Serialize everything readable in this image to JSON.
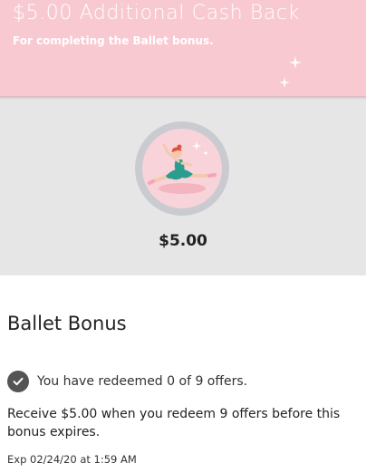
{
  "banner": {
    "title": "$5.00 Additional Cash Back",
    "subtitle": "For completing the Ballet bonus.",
    "background": "#f9c9d1"
  },
  "hero": {
    "badge_icon": "ballerina-icon",
    "amount": "$5.00"
  },
  "bonus": {
    "title": "Ballet Bonus",
    "progress_icon": "checkmark-circle-icon",
    "progress_text": "You have redeemed 0 of 9 offers.",
    "offers_redeemed": 0,
    "offers_required": 9,
    "description": "Receive $5.00 when you redeem 9 offers before this bonus expires.",
    "expiry": "Exp 02/24/20 at 1:59 AM"
  }
}
